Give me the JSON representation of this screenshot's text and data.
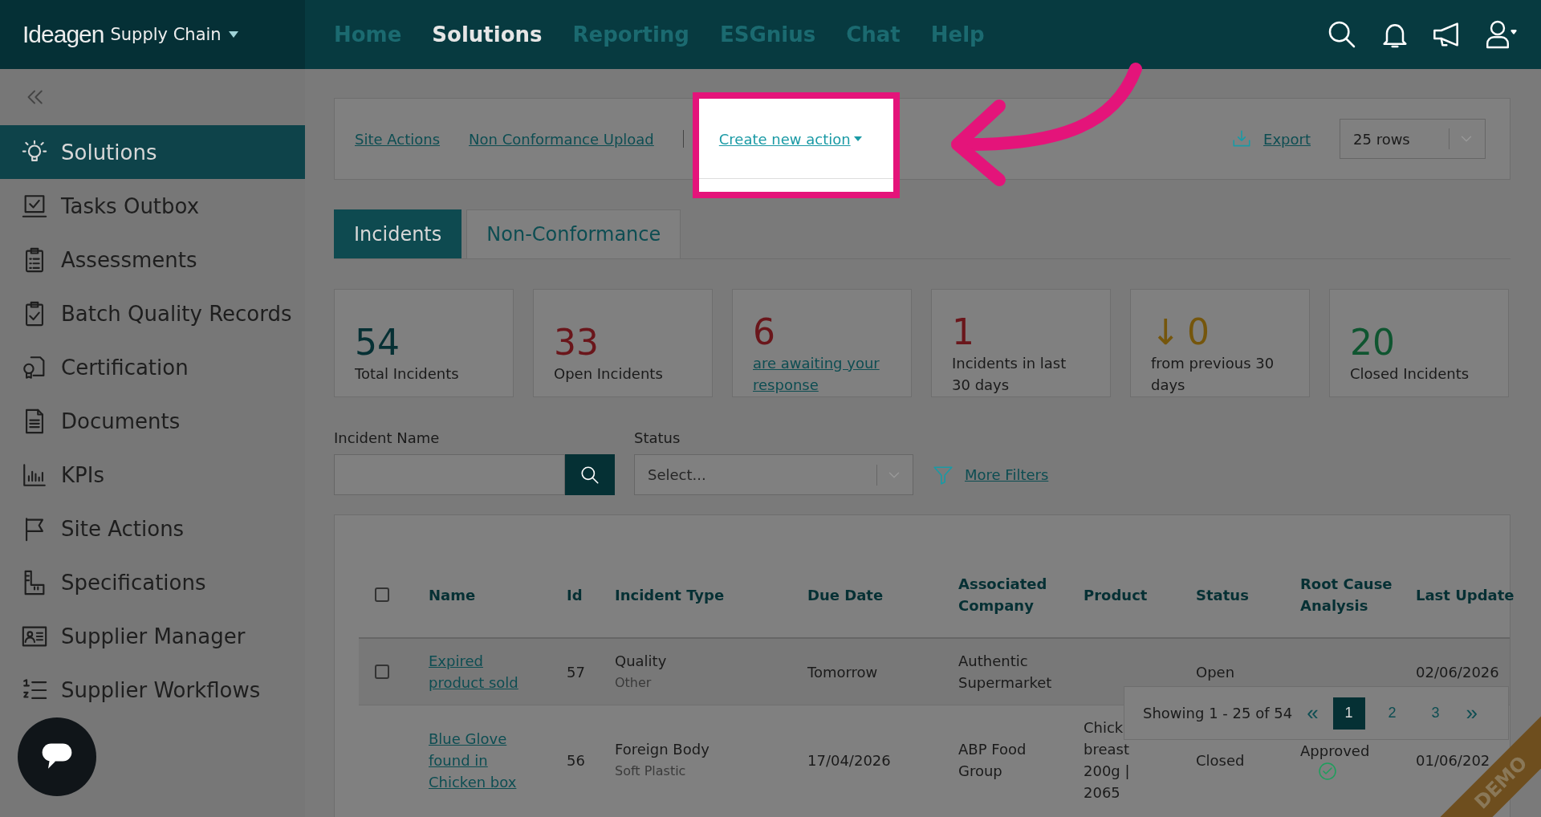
{
  "header": {
    "logo": "Ideagen",
    "product": "Supply Chain",
    "nav": [
      {
        "label": "Home",
        "selected": false
      },
      {
        "label": "Solutions",
        "selected": true
      },
      {
        "label": "Reporting",
        "selected": false
      },
      {
        "label": "ESGnius",
        "selected": false
      },
      {
        "label": "Chat",
        "selected": false
      },
      {
        "label": "Help",
        "selected": false
      }
    ]
  },
  "sidebar": {
    "items": [
      {
        "label": "Solutions",
        "selected": true
      },
      {
        "label": "Tasks Outbox",
        "selected": false
      },
      {
        "label": "Assessments",
        "selected": false
      },
      {
        "label": "Batch Quality Records",
        "selected": false
      },
      {
        "label": "Certification",
        "selected": false
      },
      {
        "label": "Documents",
        "selected": false
      },
      {
        "label": "KPIs",
        "selected": false
      },
      {
        "label": "Site Actions",
        "selected": false
      },
      {
        "label": "Specifications",
        "selected": false
      },
      {
        "label": "Supplier Manager",
        "selected": false
      },
      {
        "label": "Supplier Workflows",
        "selected": false
      }
    ]
  },
  "action_bar": {
    "links": [
      "Site Actions",
      "Non Conformance Upload"
    ],
    "create_action": "Create new action",
    "export": "Export",
    "rows_select": "25 rows"
  },
  "tabs": [
    {
      "label": "Incidents",
      "selected": true
    },
    {
      "label": "Non-Conformance",
      "selected": false
    }
  ],
  "stats": [
    {
      "value": "54",
      "label": "Total Incidents",
      "color": "#063034",
      "kind": "text"
    },
    {
      "value": "33",
      "label": "Open Incidents",
      "color": "#6a161b",
      "kind": "text"
    },
    {
      "value": "6",
      "label": "are awaiting your response",
      "color": "#6a161b",
      "kind": "link"
    },
    {
      "value": "1",
      "label": "Incidents in last 30 days",
      "color": "#6a161b",
      "kind": "text"
    },
    {
      "value": "0",
      "trend": "↓",
      "label": "from previous 30 days",
      "color": "#75560c",
      "kind": "text"
    },
    {
      "value": "20",
      "label": "Closed Incidents",
      "color": "#0f5530",
      "kind": "text"
    }
  ],
  "filters": {
    "name_label": "Incident Name",
    "status_label": "Status",
    "status_placeholder": "Select...",
    "more_filters": "More Filters"
  },
  "table": {
    "select_all": {
      "checked": false
    },
    "columns": [
      "Name",
      "Id",
      "Incident Type",
      "Due Date",
      "Associated Company",
      "Product",
      "Status",
      "Root Cause Analysis",
      "Last Update"
    ],
    "rows": [
      {
        "checkbox": {
          "checked": false
        },
        "name": "Expired product sold",
        "id": "57",
        "type": "Quality",
        "subtype": "Other",
        "due": "Tomorrow",
        "company": "Authentic Supermarket",
        "product": "",
        "status": "Open",
        "rca": "",
        "rca_done": false,
        "updated": "02/06/2026"
      },
      {
        "name": "Blue Glove found in Chicken box",
        "id": "56",
        "type": "Foreign Body",
        "subtype": "Soft Plastic",
        "due": "17/04/2026",
        "company": "ABP Food Group",
        "product": "Chick breast 200g | 2065",
        "status": "Closed",
        "rca": "Approved",
        "rca_done": true,
        "updated": "01/06/202"
      }
    ]
  },
  "pagination": {
    "summary": "Showing 1 - 25 of 54",
    "first": "«",
    "last": "»",
    "pages": [
      {
        "label": "1",
        "selected": true
      },
      {
        "label": "2",
        "selected": false
      },
      {
        "label": "3",
        "selected": false
      }
    ]
  },
  "ribbon": "DEMO"
}
